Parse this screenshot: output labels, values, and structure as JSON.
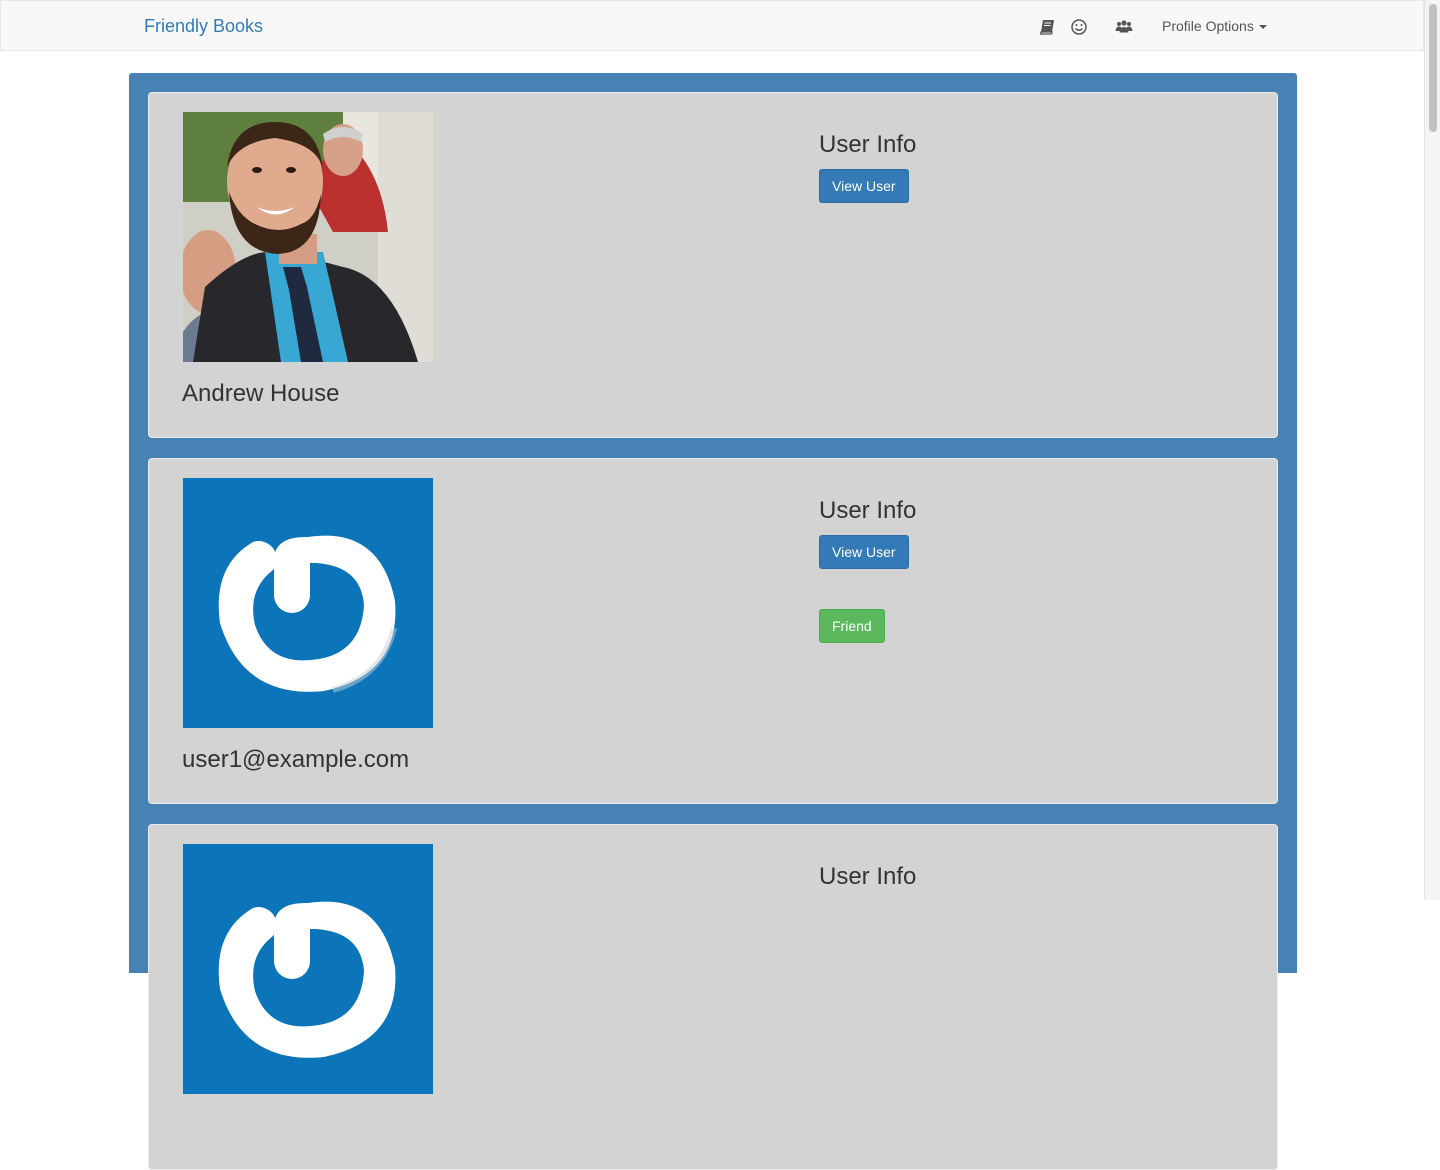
{
  "navbar": {
    "brand": "Friendly Books",
    "icons": [
      "book-icon",
      "smiley-icon",
      "users-icon"
    ],
    "profile_options": "Profile Options"
  },
  "users": [
    {
      "name": "Andrew House",
      "info_title": "User Info",
      "view_label": "View User",
      "avatar": "photo"
    },
    {
      "name": "user1@example.com",
      "info_title": "User Info",
      "view_label": "View User",
      "friend_label": "Friend",
      "avatar": "power-logo"
    },
    {
      "info_title": "User Info",
      "avatar": "power-logo"
    }
  ],
  "colors": {
    "container": "#4682b4",
    "card": "#d3d3d3",
    "primary": "#337ab7",
    "success": "#5cb85c",
    "avatar_blue": "#0c74b8"
  }
}
